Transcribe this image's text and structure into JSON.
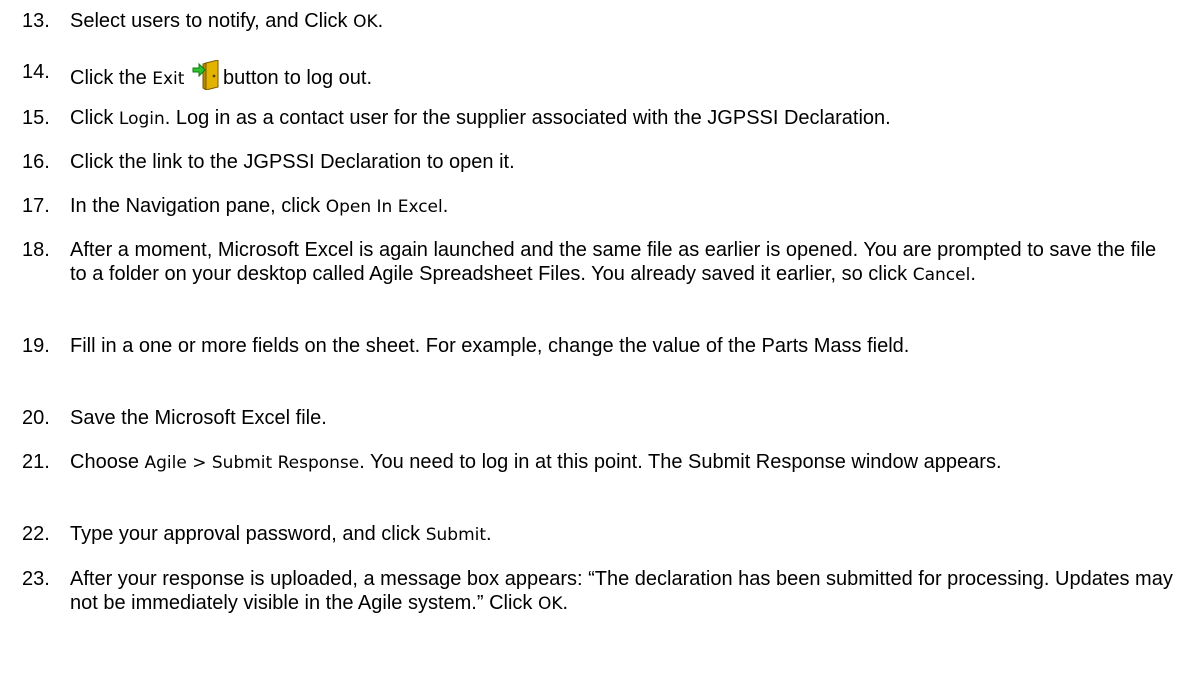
{
  "steps": [
    {
      "num": "13.",
      "parts": [
        {
          "t": "Select users to notify, and Click ",
          "ui": false
        },
        {
          "t": "OK",
          "ui": true
        },
        {
          "t": ".",
          "ui": false
        }
      ]
    },
    {
      "num": "14.",
      "parts": [
        {
          "t": "Click the ",
          "ui": false
        },
        {
          "t": "Exit",
          "ui": true
        },
        {
          "t": " ",
          "ui": false
        },
        {
          "icon": "exit-door-icon"
        },
        {
          "t": "button to log out.",
          "ui": false
        }
      ]
    },
    {
      "num": "15.",
      "parts": [
        {
          "t": "Click ",
          "ui": false
        },
        {
          "t": "Login",
          "ui": true
        },
        {
          "t": ". Log in as a contact user for the supplier associated with the JGPSSI Declaration.",
          "ui": false
        }
      ]
    },
    {
      "num": "16.",
      "parts": [
        {
          "t": "Click the link to the JGPSSI Declaration to open it.",
          "ui": false
        }
      ]
    },
    {
      "num": "17.",
      "parts": [
        {
          "t": "In the Navigation pane, click ",
          "ui": false
        },
        {
          "t": "Open In Excel",
          "ui": true
        },
        {
          "t": ".",
          "ui": false
        }
      ]
    },
    {
      "num": "18.",
      "parts": [
        {
          "t": " After a moment, Microsoft Excel is again launched and the same file as earlier is opened. You are prompted to save the file to a folder on your desktop called Agile Spreadsheet Files. You already saved it earlier, so click ",
          "ui": false
        },
        {
          "t": "Cancel",
          "ui": true
        },
        {
          "t": ".",
          "ui": false
        }
      ]
    },
    {
      "num": "19.",
      "parts": [
        {
          "t": " Fill in a one or more fields on the sheet. For example, change the value of the Parts Mass field.",
          "ui": false
        }
      ]
    },
    {
      "num": "20.",
      "parts": [
        {
          "t": " Save the Microsoft Excel file.",
          "ui": false
        }
      ]
    },
    {
      "num": "21.",
      "parts": [
        {
          "t": "Choose ",
          "ui": false
        },
        {
          "t": "Agile > Submit Response",
          "ui": true
        },
        {
          "t": ". You need to log in at this point. The Submit Response window appears.",
          "ui": false
        }
      ]
    },
    {
      "num": "22.",
      "parts": [
        {
          "t": "Type your approval password, and click ",
          "ui": false
        },
        {
          "t": "Submit",
          "ui": true
        },
        {
          "t": ".",
          "ui": false
        }
      ]
    },
    {
      "num": "23.",
      "parts": [
        {
          "t": "After your response is uploaded, a message box appears: “The declaration has been submitted for processing. Updates may not be immediately visible in the Agile system.” Click ",
          "ui": false
        },
        {
          "t": "OK",
          "ui": true
        },
        {
          "t": ".",
          "ui": false
        }
      ]
    }
  ]
}
